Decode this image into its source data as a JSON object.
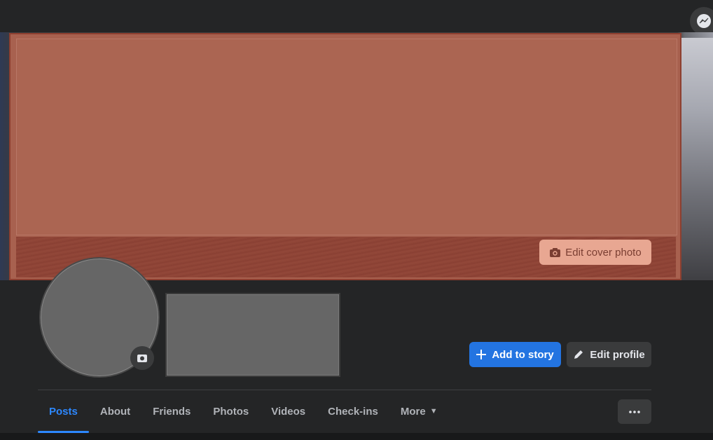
{
  "cover": {
    "edit_cover_label": "Edit cover photo",
    "edit_cover_icon": "camera-icon"
  },
  "actions": {
    "add_story_label": "Add to story",
    "add_story_icon": "plus-icon",
    "edit_profile_label": "Edit profile",
    "edit_profile_icon": "pencil-icon"
  },
  "tabs": [
    {
      "label": "Posts",
      "active": true
    },
    {
      "label": "About"
    },
    {
      "label": "Friends"
    },
    {
      "label": "Photos"
    },
    {
      "label": "Videos"
    },
    {
      "label": "Check-ins"
    },
    {
      "label": "More",
      "icon": "caret-down-icon"
    }
  ],
  "more_menu_icon": "ellipsis-icon",
  "topbar": {
    "messenger_icon": "messenger-icon"
  },
  "colors": {
    "accent": "#2d88ff",
    "primary_button": "#2374e1",
    "background": "#242526",
    "secondary_button": "#3a3b3c"
  }
}
